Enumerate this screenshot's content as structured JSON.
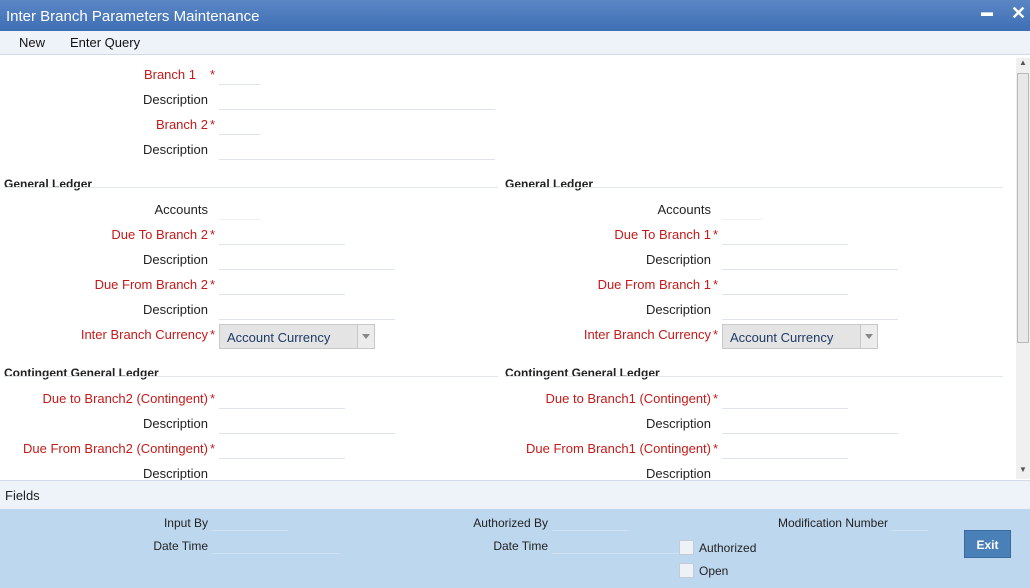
{
  "window": {
    "title": "Inter Branch Parameters Maintenance",
    "minimize_glyph": "▬",
    "close_glyph": "✕"
  },
  "toolbar": {
    "new_label": "New",
    "enter_query_label": "Enter Query"
  },
  "header": {
    "branch1_label": "Branch 1",
    "description1_label": "Description",
    "branch2_label": "Branch 2",
    "description2_label": "Description",
    "required_marker": "*"
  },
  "gl_left": {
    "section_title": "General Ledger",
    "accounts_label": "Accounts",
    "due_to_label": "Due To Branch 2",
    "due_to_desc_label": "Description",
    "due_from_label": "Due From Branch 2",
    "due_from_desc_label": "Description",
    "currency_label": "Inter Branch Currency",
    "currency_value": "Account Currency"
  },
  "gl_right": {
    "section_title": "General Ledger",
    "accounts_label": "Accounts",
    "due_to_label": "Due To Branch 1",
    "due_to_desc_label": "Description",
    "due_from_label": "Due From Branch 1",
    "due_from_desc_label": "Description",
    "currency_label": "Inter Branch Currency",
    "currency_value": "Account Currency"
  },
  "cgl_left": {
    "section_title": "Contingent General Ledger",
    "due_to_label": "Due to Branch2 (Contingent)",
    "due_to_desc_label": "Description",
    "due_from_label": "Due From Branch2 (Contingent)",
    "due_from_desc_label": "Description"
  },
  "cgl_right": {
    "section_title": "Contingent General Ledger",
    "due_to_label": "Due to Branch1 (Contingent)",
    "due_to_desc_label": "Description",
    "due_from_label": "Due From Branch1 (Contingent)",
    "due_from_desc_label": "Description"
  },
  "fields_bar": {
    "label": "Fields"
  },
  "audit": {
    "input_by_label": "Input By",
    "date_time_label": "Date Time",
    "authorized_by_label": "Authorized By",
    "auth_date_time_label": "Date Time",
    "modification_number_label": "Modification Number",
    "authorized_label": "Authorized",
    "open_label": "Open",
    "exit_label": "Exit"
  },
  "colors": {
    "titlebar": "#3e6fb4",
    "required": "#c41a1a",
    "footer": "#bdd7ee",
    "exit_button": "#4a80b8"
  }
}
